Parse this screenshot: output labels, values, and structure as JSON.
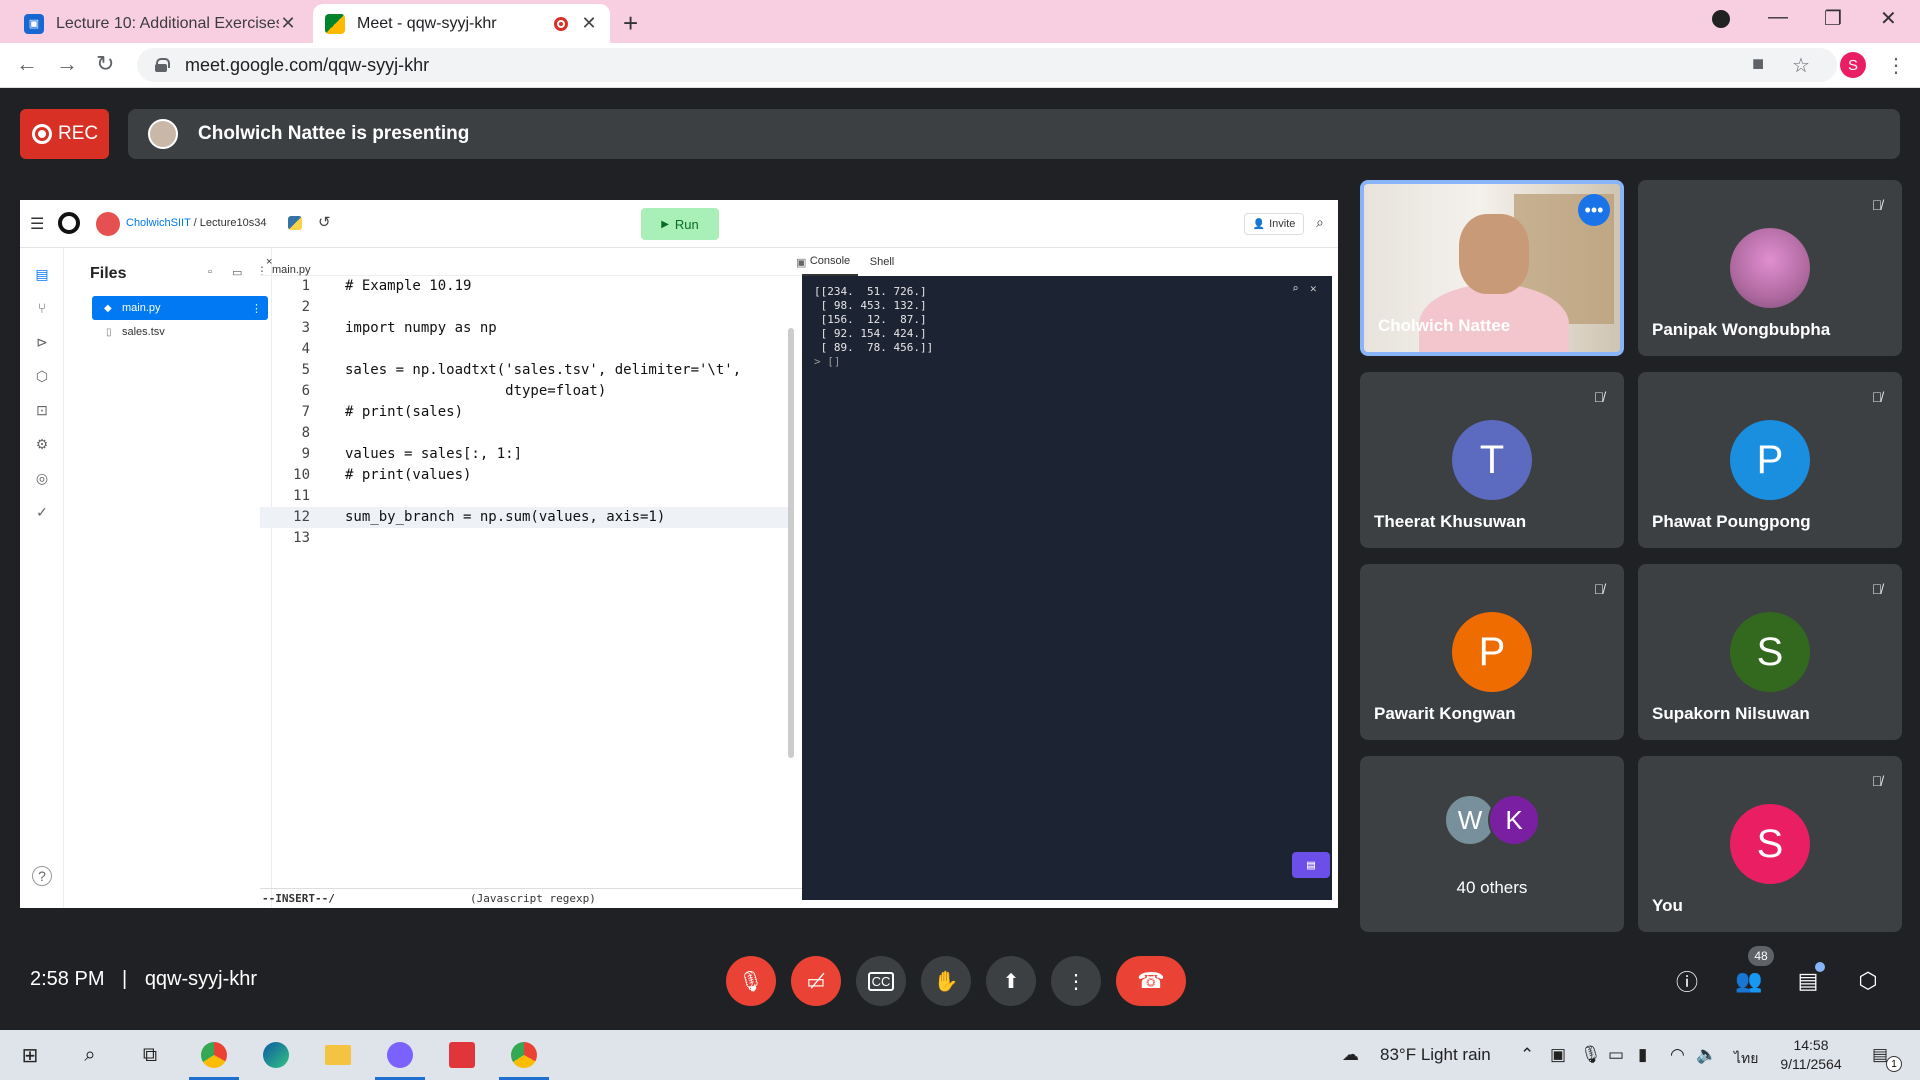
{
  "browser": {
    "tabs": [
      {
        "title": "Lecture 10: Additional Exercises",
        "close": "✕"
      },
      {
        "title": "Meet - qqw-syyj-khr",
        "close": "✕"
      }
    ],
    "new_tab": "+",
    "url": "meet.google.com/qqw-syyj-khr",
    "profile_initial": "S"
  },
  "meet_header": {
    "rec_label": "REC",
    "presenting_text": "Cholwich Nattee is presenting"
  },
  "replit": {
    "user": "CholwichSIIT",
    "separator": "/",
    "project": "Lecture10s34",
    "run_label": "Run",
    "invite_label": "Invite",
    "files_title": "Files",
    "files": [
      "main.py",
      "sales.tsv"
    ],
    "editor_tab": "main.py",
    "console_tab": "Console",
    "shell_tab": "Shell",
    "status_mode": "--INSERT--/",
    "status_mode2": "(Javascript regexp)",
    "help": "?",
    "console_lines": [
      "[[234.  51. 726.]",
      " [ 98. 453. 132.]",
      " [156.  12.  87.]",
      " [ 92. 154. 424.]",
      " [ 89.  78. 456.]]"
    ],
    "console_prompt": "> []",
    "code_lines": [
      {
        "n": "1",
        "text": "# Example 10.19"
      },
      {
        "n": "2",
        "text": ""
      },
      {
        "n": "3",
        "text": "import numpy as np"
      },
      {
        "n": "4",
        "text": ""
      },
      {
        "n": "5",
        "text": "sales = np.loadtxt('sales.tsv', delimiter='\\t',"
      },
      {
        "n": "6",
        "text": "                   dtype=float)"
      },
      {
        "n": "7",
        "text": "# print(sales)"
      },
      {
        "n": "8",
        "text": ""
      },
      {
        "n": "9",
        "text": "values = sales[:, 1:]"
      },
      {
        "n": "10",
        "text": "# print(values)"
      },
      {
        "n": "11",
        "text": ""
      },
      {
        "n": "12",
        "text": "sum_by_branch = np.sum(values, axis=1)"
      },
      {
        "n": "13",
        "text": ""
      }
    ]
  },
  "participants": {
    "presenter": "Cholwich Nattee",
    "tiles": [
      {
        "name": "Panipak Wongbubpha",
        "initial": "",
        "color": "#c9a0c8"
      },
      {
        "name": "Theerat Khusuwan",
        "initial": "T",
        "color": "#5c6bc0"
      },
      {
        "name": "Phawat Poungpong",
        "initial": "P",
        "color": "#1a8fe0"
      },
      {
        "name": "Pawarit Kongwan",
        "initial": "P",
        "color": "#ef6c00"
      },
      {
        "name": "Supakorn Nilsuwan",
        "initial": "S",
        "color": "#33691e"
      },
      {
        "name": "You",
        "initial": "S",
        "color": "#e91e63"
      }
    ],
    "others": {
      "initials": [
        "W",
        "K"
      ],
      "colors": [
        "#78909c",
        "#7b1fa2"
      ],
      "count_label": "40 others"
    }
  },
  "bottom_bar": {
    "time": "2:58 PM",
    "divider": "|",
    "meeting_code": "qqw-syyj-khr",
    "participant_count": "48"
  },
  "taskbar": {
    "weather": "83°F  Light rain",
    "lang": "ไทย",
    "time": "14:58",
    "date": "9/11/2564",
    "notif_count": "1"
  }
}
